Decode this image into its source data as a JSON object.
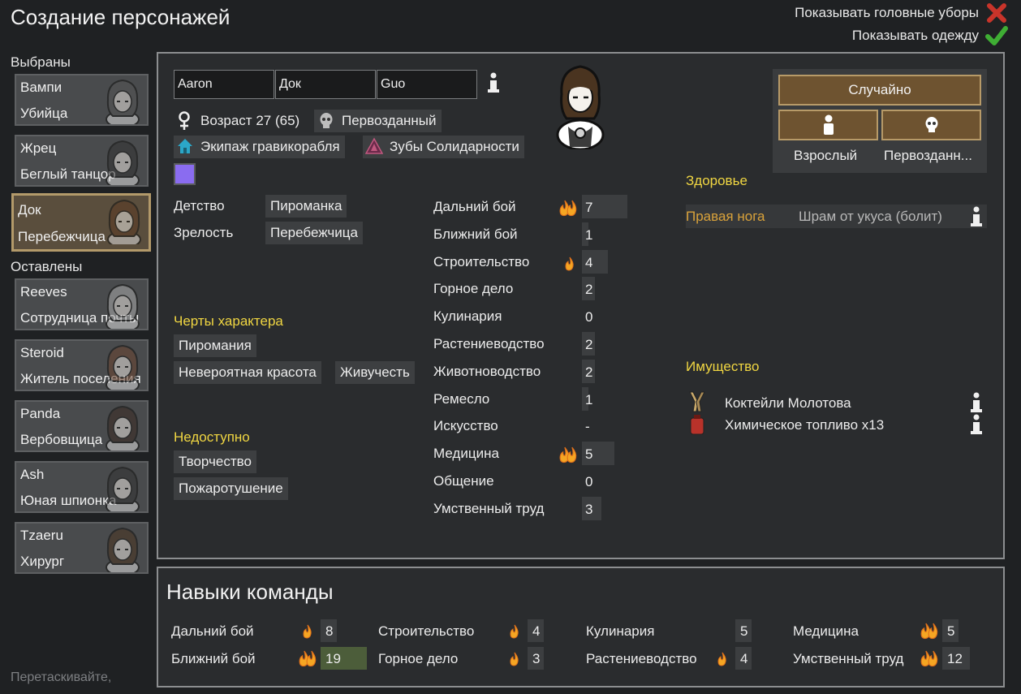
{
  "header": {
    "title": "Создание персонажей",
    "show_headgear_label": "Показывать головные уборы",
    "show_clothes_label": "Показывать одежду"
  },
  "sidebar": {
    "chosen_label": "Выбраны",
    "left_label": "Оставлены",
    "hint": "Перетаскивайте,",
    "chosen": [
      {
        "name": "Вампи",
        "role": "Убийца"
      },
      {
        "name": "Жрец",
        "role": "Беглый танцор"
      },
      {
        "name": "Док",
        "role": "Перебежчица"
      }
    ],
    "left": [
      {
        "name": "Reeves",
        "role": "Сотрудница почты"
      },
      {
        "name": "Steroid",
        "role": "Житель поселения"
      },
      {
        "name": "Panda",
        "role": "Вербовщица"
      },
      {
        "name": "Ash",
        "role": "Юная шпионка"
      },
      {
        "name": "Tzaeru",
        "role": "Хирург"
      }
    ]
  },
  "pawn": {
    "first_name": "Aaron",
    "nick_name": "Док",
    "last_name": "Guo",
    "age": "Возраст 27 (65)",
    "xenotype": "Первозданный",
    "faction": "Экипаж гравикорабля",
    "ideo": "Зубы Солидарности",
    "favorite_color": "#8a6cf0",
    "childhood_label": "Детство",
    "childhood": "Пироманка",
    "adulthood_label": "Зрелость",
    "adulthood": "Перебежчица",
    "traits_label": "Черты характера",
    "traits": [
      "Пиромания",
      "Невероятная красота",
      "Живучесть"
    ],
    "disabled_label": "Недоступно",
    "disabled": [
      "Творчество",
      "Пожаротушение"
    ]
  },
  "skills": [
    {
      "name": "Дальний бой",
      "value": "7",
      "passion": 2,
      "level": 7
    },
    {
      "name": "Ближний бой",
      "value": "1",
      "passion": 0,
      "level": 1
    },
    {
      "name": "Строительство",
      "value": "4",
      "passion": 1,
      "level": 4
    },
    {
      "name": "Горное дело",
      "value": "2",
      "passion": 0,
      "level": 2
    },
    {
      "name": "Кулинария",
      "value": "0",
      "passion": 0,
      "level": 0
    },
    {
      "name": "Растениеводство",
      "value": "2",
      "passion": 0,
      "level": 2
    },
    {
      "name": "Животноводство",
      "value": "2",
      "passion": 0,
      "level": 2
    },
    {
      "name": "Ремесло",
      "value": "1",
      "passion": 0,
      "level": 1
    },
    {
      "name": "Искусство",
      "value": "-",
      "passion": 0,
      "level": 0
    },
    {
      "name": "Медицина",
      "value": "5",
      "passion": 2,
      "level": 5
    },
    {
      "name": "Общение",
      "value": "0",
      "passion": 0,
      "level": 0
    },
    {
      "name": "Умственный труд",
      "value": "3",
      "passion": 0,
      "level": 3
    }
  ],
  "randomize": {
    "random_label": "Случайно",
    "adult_label": "Взрослый",
    "xeno_label": "Первозданн..."
  },
  "health": {
    "title": "Здоровье",
    "part": "Правая нога",
    "injury": "Шрам от укуса (болит)"
  },
  "possessions": {
    "title": "Имущество",
    "items": [
      "Коктейли Молотова",
      "Химическое топливо x13"
    ]
  },
  "team": {
    "title": "Навыки команды",
    "skills": [
      {
        "name": "Дальний бой",
        "value": "8",
        "passion": 1,
        "highlight": false
      },
      {
        "name": "Ближний бой",
        "value": "19",
        "passion": 2,
        "highlight": true
      },
      {
        "name": "Строительство",
        "value": "4",
        "passion": 1,
        "highlight": false
      },
      {
        "name": "Горное дело",
        "value": "3",
        "passion": 1,
        "highlight": false
      },
      {
        "name": "Кулинария",
        "value": "5",
        "passion": 0,
        "highlight": false
      },
      {
        "name": "Растениеводство",
        "value": "4",
        "passion": 1,
        "highlight": false
      },
      {
        "name": "Медицина",
        "value": "5",
        "passion": 2,
        "highlight": false
      },
      {
        "name": "Умственный труд",
        "value": "12",
        "passion": 2,
        "highlight": false
      }
    ]
  },
  "colors": {
    "accent_yellow": "#f0d642",
    "selected_border": "#b39a6a",
    "team_highlight": "#4c5d3a"
  }
}
